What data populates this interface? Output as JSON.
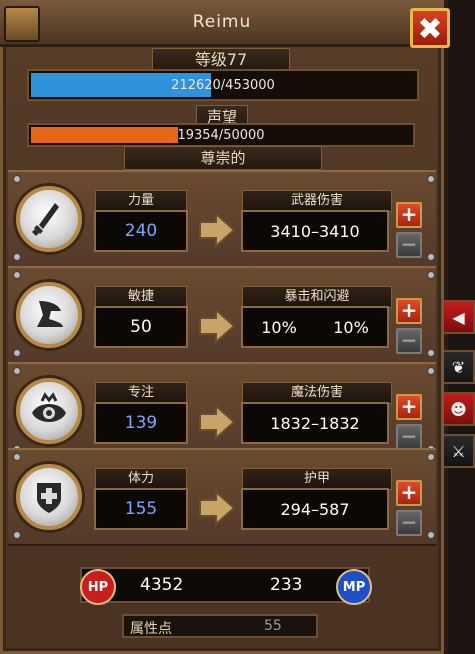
{
  "window": {
    "title": "Reimu",
    "close_label": "✖"
  },
  "level": {
    "label": "等级77",
    "xp_text": "212620/453000",
    "xp_fraction": 0.469
  },
  "reputation": {
    "label": "声望",
    "value_text": "19354/50000",
    "fraction": 0.387,
    "rank": "尊崇的"
  },
  "stats": [
    {
      "name": "力量",
      "value": "240",
      "value_color": "#7da6ff",
      "result_name": "武器伤害",
      "result_a": "3410–3410",
      "result_b": "",
      "icon": "sword-icon"
    },
    {
      "name": "敏捷",
      "value": "50",
      "value_color": "#ffffff",
      "result_name": "暴击和闪避",
      "result_a": "10%",
      "result_b": "10%",
      "icon": "boot-icon"
    },
    {
      "name": "专注",
      "value": "139",
      "value_color": "#7da6ff",
      "result_name": "魔法伤害",
      "result_a": "1832–1832",
      "result_b": "",
      "icon": "eye-icon"
    },
    {
      "name": "体力",
      "value": "155",
      "value_color": "#7da6ff",
      "result_name": "护甲",
      "result_a": "294–587",
      "result_b": "",
      "icon": "shield-cross-icon"
    }
  ],
  "buttons": {
    "plus": "+",
    "minus": "−"
  },
  "bottom": {
    "hp_label": "HP",
    "hp_value": "4352",
    "mp_label": "MP",
    "mp_value": "233",
    "attr_label": "属性点",
    "attr_value": "55"
  },
  "colors": {
    "xp_bar": "#2f92dc",
    "rep_bar": "#e8661a",
    "hp_orb": "#c81e1e",
    "mp_orb": "#1e4fc8"
  },
  "side_tabs": [
    "arrow-left-icon",
    "paw-icon",
    "portrait-icon",
    "sword-small-icon"
  ]
}
